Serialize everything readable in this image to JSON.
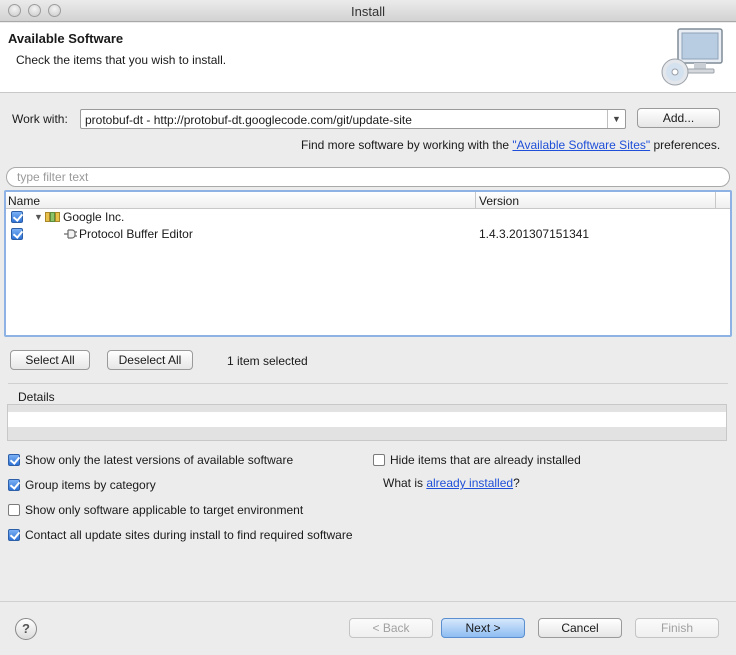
{
  "window": {
    "title": "Install"
  },
  "banner": {
    "title": "Available Software",
    "subtitle": "Check the items that you wish to install."
  },
  "work_with": {
    "label": "Work with:",
    "value": "protobuf-dt - http://protobuf-dt.googlecode.com/git/update-site",
    "add_label": "Add..."
  },
  "hint": {
    "prefix": "Find more software by working with the ",
    "link": "\"Available Software Sites\"",
    "suffix": " preferences."
  },
  "filter": {
    "placeholder": "type filter text"
  },
  "tree": {
    "columns": {
      "name": "Name",
      "version": "Version"
    },
    "rows": [
      {
        "name": "Google Inc.",
        "version": "",
        "checked": true,
        "level": 0
      },
      {
        "name": "Protocol Buffer Editor",
        "version": "1.4.3.201307151341",
        "checked": true,
        "level": 1
      }
    ]
  },
  "selection": {
    "select_all": "Select All",
    "deselect_all": "Deselect All",
    "count_text": "1 item selected"
  },
  "details": {
    "label": "Details"
  },
  "options": {
    "latest_only": {
      "label": "Show only the latest versions of available software",
      "checked": true
    },
    "group_by_category": {
      "label": "Group items by category",
      "checked": true
    },
    "target_env_only": {
      "label": "Show only software applicable to target environment",
      "checked": false
    },
    "contact_all_sites": {
      "label": "Contact all update sites during install to find required software",
      "checked": true
    },
    "hide_installed": {
      "label": "Hide items that are already installed",
      "checked": false
    },
    "what_is_prefix": "What is ",
    "what_is_link": "already installed",
    "what_is_suffix": "?"
  },
  "footer": {
    "help": "?",
    "back": "< Back",
    "next": "Next >",
    "cancel": "Cancel",
    "finish": "Finish"
  },
  "colors": {
    "accent": "#2e73d6",
    "link": "#1f4fd8",
    "focus_border": "#8db2e3"
  }
}
